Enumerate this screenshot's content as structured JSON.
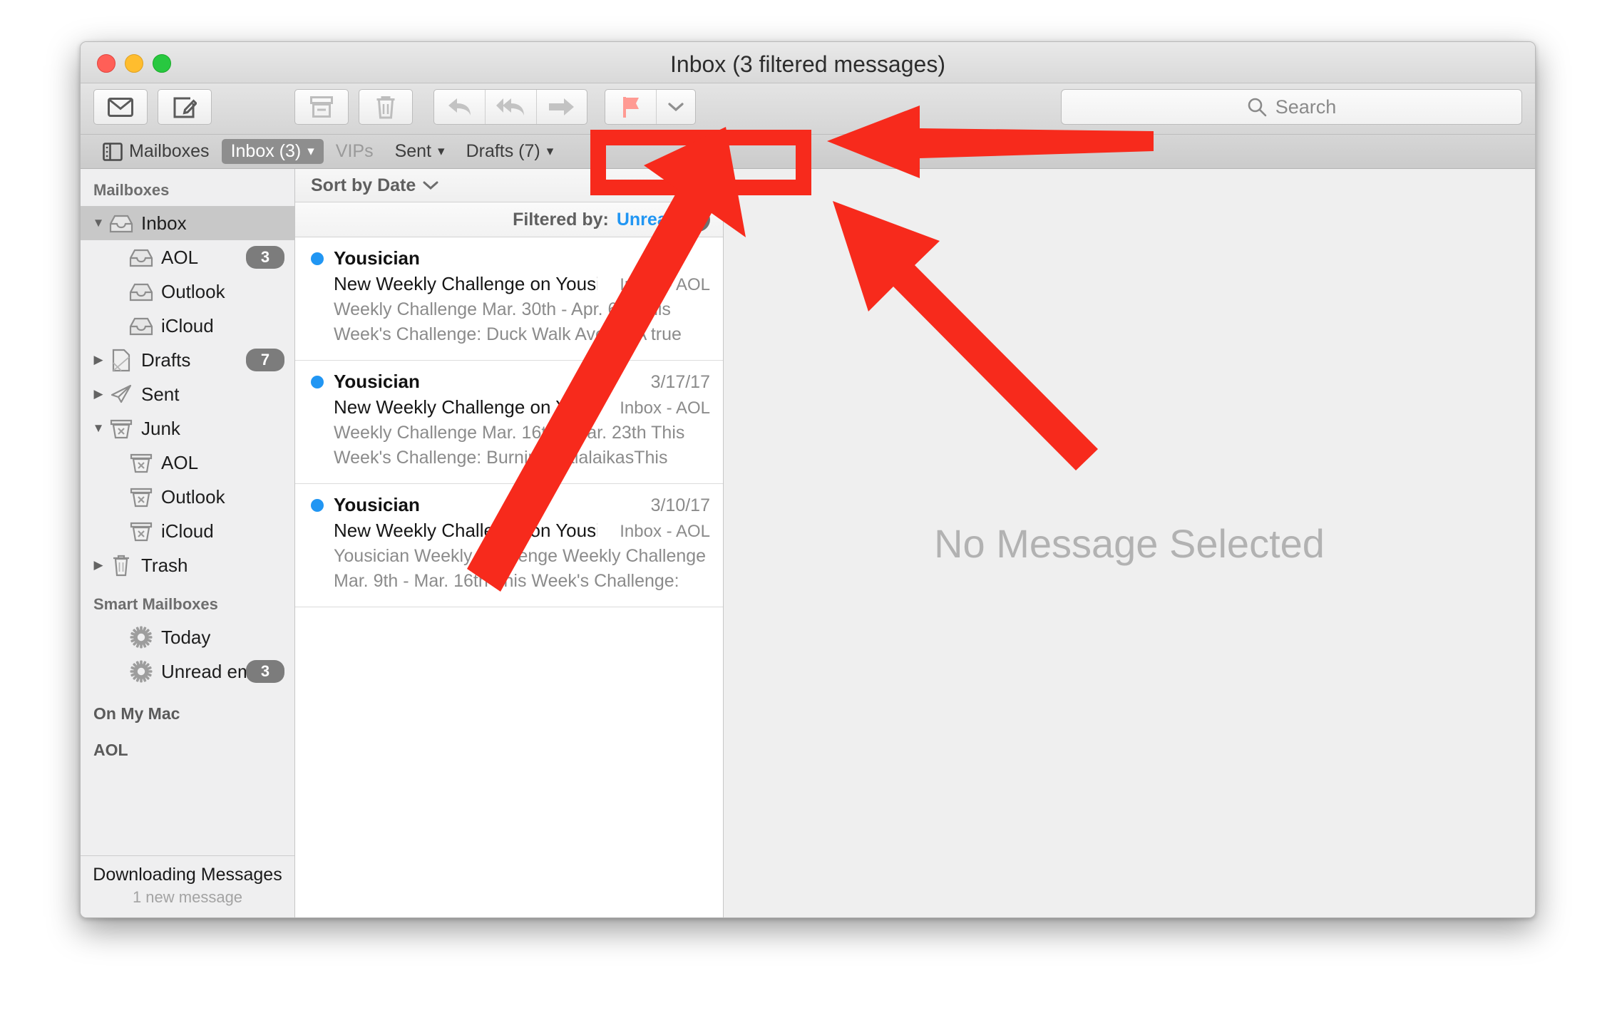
{
  "window": {
    "title": "Inbox (3 filtered messages)",
    "traffic_lights": [
      "close",
      "minimize",
      "zoom"
    ]
  },
  "toolbar": {
    "buttons": [
      {
        "name": "get-mail-button",
        "icon": "envelope-icon"
      },
      {
        "name": "compose-button",
        "icon": "compose-pencil-icon"
      },
      {
        "name": "archive-button",
        "icon": "archive-box-icon"
      },
      {
        "name": "delete-button",
        "icon": "trash-icon"
      },
      {
        "name": "reply-button",
        "icon": "reply-arrow-icon"
      },
      {
        "name": "reply-all-button",
        "icon": "reply-all-arrow-icon"
      },
      {
        "name": "forward-button",
        "icon": "forward-arrow-icon"
      },
      {
        "name": "flag-button",
        "icon": "flag-icon"
      },
      {
        "name": "flag-menu-button",
        "icon": "chevron-down-icon"
      }
    ],
    "search": {
      "placeholder": "Search",
      "icon": "search-icon",
      "value": ""
    }
  },
  "favorites_bar": {
    "items": [
      {
        "label": "Mailboxes",
        "icon": "sidebar-toggle-icon",
        "selected": false,
        "dim": false,
        "chevron": false
      },
      {
        "label": "Inbox (3)",
        "selected": true,
        "dim": false,
        "chevron": true
      },
      {
        "label": "VIPs",
        "selected": false,
        "dim": true,
        "chevron": false
      },
      {
        "label": "Sent",
        "selected": false,
        "dim": false,
        "chevron": true
      },
      {
        "label": "Drafts (7)",
        "selected": false,
        "dim": false,
        "chevron": true
      }
    ]
  },
  "sidebar": {
    "header": "Mailboxes",
    "rows": [
      {
        "label": "Inbox",
        "icon": "inbox-tray-icon",
        "level": 0,
        "disclosure": "open",
        "selected": true,
        "badge": ""
      },
      {
        "label": "AOL",
        "icon": "inbox-tray-icon",
        "level": 1,
        "disclosure": "",
        "selected": false,
        "badge": "3"
      },
      {
        "label": "Outlook",
        "icon": "inbox-tray-icon",
        "level": 1,
        "disclosure": "",
        "selected": false,
        "badge": ""
      },
      {
        "label": "iCloud",
        "icon": "inbox-tray-icon",
        "level": 1,
        "disclosure": "",
        "selected": false,
        "badge": ""
      },
      {
        "label": "Drafts",
        "icon": "drafts-page-icon",
        "level": 0,
        "disclosure": "closed",
        "selected": false,
        "badge": "7"
      },
      {
        "label": "Sent",
        "icon": "sent-paperplane-icon",
        "level": 0,
        "disclosure": "closed",
        "selected": false,
        "badge": ""
      },
      {
        "label": "Junk",
        "icon": "junk-bin-icon",
        "level": 0,
        "disclosure": "open",
        "selected": false,
        "badge": ""
      },
      {
        "label": "AOL",
        "icon": "junk-bin-icon",
        "level": 1,
        "disclosure": "",
        "selected": false,
        "badge": ""
      },
      {
        "label": "Outlook",
        "icon": "junk-bin-icon",
        "level": 1,
        "disclosure": "",
        "selected": false,
        "badge": ""
      },
      {
        "label": "iCloud",
        "icon": "junk-bin-icon",
        "level": 1,
        "disclosure": "",
        "selected": false,
        "badge": ""
      },
      {
        "label": "Trash",
        "icon": "trash-icon",
        "level": 0,
        "disclosure": "closed",
        "selected": false,
        "badge": ""
      }
    ],
    "smart_header": "Smart Mailboxes",
    "smart_rows": [
      {
        "label": "Today",
        "icon": "gear-icon",
        "badge": ""
      },
      {
        "label": "Unread email...",
        "icon": "gear-icon",
        "badge": "3"
      }
    ],
    "on_my_mac_header": "On My Mac",
    "accounts": [
      "AOL"
    ],
    "footer": {
      "status": "Downloading Messages",
      "detail": "1 new message"
    }
  },
  "message_list": {
    "sort_label": "Sort by Date",
    "sort_icon": "chevron-down-icon",
    "filter": {
      "label": "Filtered by:",
      "value": "Unread",
      "icon": "filter-funnel-icon"
    },
    "messages": [
      {
        "sender": "Yousician",
        "date": "",
        "subject": "New Weekly Challenge on Yousician:...",
        "mailbox": "Inbox - AOL",
        "preview": "Weekly Challenge Mar. 30th - Apr. 6th This Week's Challenge: Duck Walk AvenueA true rock and ico...",
        "unread": true
      },
      {
        "sender": "Yousician",
        "date": "3/17/17",
        "subject": "New Weekly Challenge on Yousician:...",
        "mailbox": "Inbox - AOL",
        "preview": "Weekly Challenge Mar. 16th - Mar. 23th This Week's Challenge: Burning BalalaikasThis week we...",
        "unread": true
      },
      {
        "sender": "Yousician",
        "date": "3/10/17",
        "subject": "New Weekly Challenge on Yousician:...",
        "mailbox": "Inbox - AOL",
        "preview": "Yousician Weekly Challenge Weekly Challenge Mar. 9th - Mar. 16th This Week's Challenge: Rock Explos...",
        "unread": true
      }
    ]
  },
  "reading_pane": {
    "empty_state": "No Message Selected"
  },
  "annotations": {
    "color": "#f72a1c",
    "highlight_box_target": "filter-bar",
    "arrows": [
      {
        "name": "horizontal-arrow-to-filter-bar",
        "direction": "left"
      },
      {
        "name": "diagonal-arrow-to-filter-bar",
        "direction": "up-left"
      },
      {
        "name": "long-diagonal-arrow-to-filter-bar",
        "direction": "up-right"
      }
    ]
  }
}
